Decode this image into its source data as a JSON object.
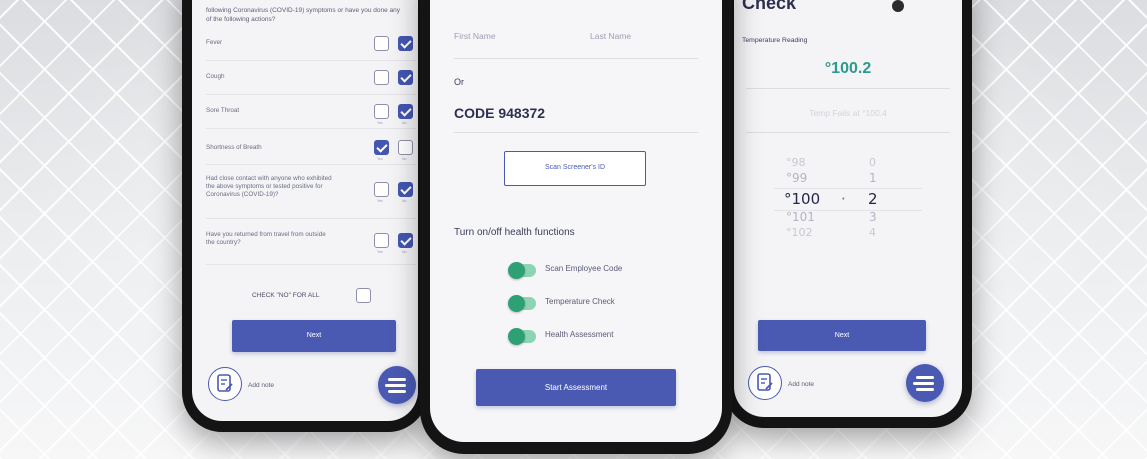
{
  "left_screen": {
    "intro": "following Coronavirus (COVID-19) symptoms or have you done any of the following actions?",
    "yes_label": "Yes",
    "no_label": "No",
    "questions": [
      {
        "text": "Fever",
        "yes": false,
        "no": true
      },
      {
        "text": "Cough",
        "yes": false,
        "no": true
      },
      {
        "text": "Sore Throat",
        "yes": false,
        "no": true
      },
      {
        "text": "Shortness of Breath",
        "yes": true,
        "no": false
      },
      {
        "text": "Had close contact with anyone who exhibited the above symptoms or tested positive for Coronavirus (COVID-19)?",
        "yes": false,
        "no": true
      },
      {
        "text": "Have you returned from travel from outside the country?",
        "yes": false,
        "no": true
      }
    ],
    "check_all_label": "CHECK \"NO\" FOR ALL",
    "next_button": "Next",
    "add_note": "Add note"
  },
  "center_screen": {
    "first_name_placeholder": "First Name",
    "last_name_placeholder": "Last Name",
    "or_label": "Or",
    "code_label": "CODE 948372",
    "scan_screener_button": "Scan Screener's ID",
    "functions_heading": "Turn on/off health functions",
    "toggles": [
      {
        "label": "Scan Employee Code",
        "on": true
      },
      {
        "label": "Temperature Check",
        "on": true
      },
      {
        "label": "Health Assessment",
        "on": true
      }
    ],
    "start_button": "Start Assessment"
  },
  "right_screen": {
    "title": "Check",
    "reading_label": "Temperature Reading",
    "reading_value": "°100.2",
    "fail_text": "Temp Fails at °100.4",
    "wheel_degrees": [
      "°98",
      "°99",
      "°100",
      "°101",
      "°102"
    ],
    "wheel_separator": "·",
    "wheel_decimals": [
      "0",
      "1",
      "2",
      "3",
      "4"
    ],
    "next_button": "Next",
    "add_note": "Add note"
  },
  "colors": {
    "primary": "#4a5ab3",
    "accent_green": "#2fa074",
    "reading_teal": "#2c9a8c"
  }
}
